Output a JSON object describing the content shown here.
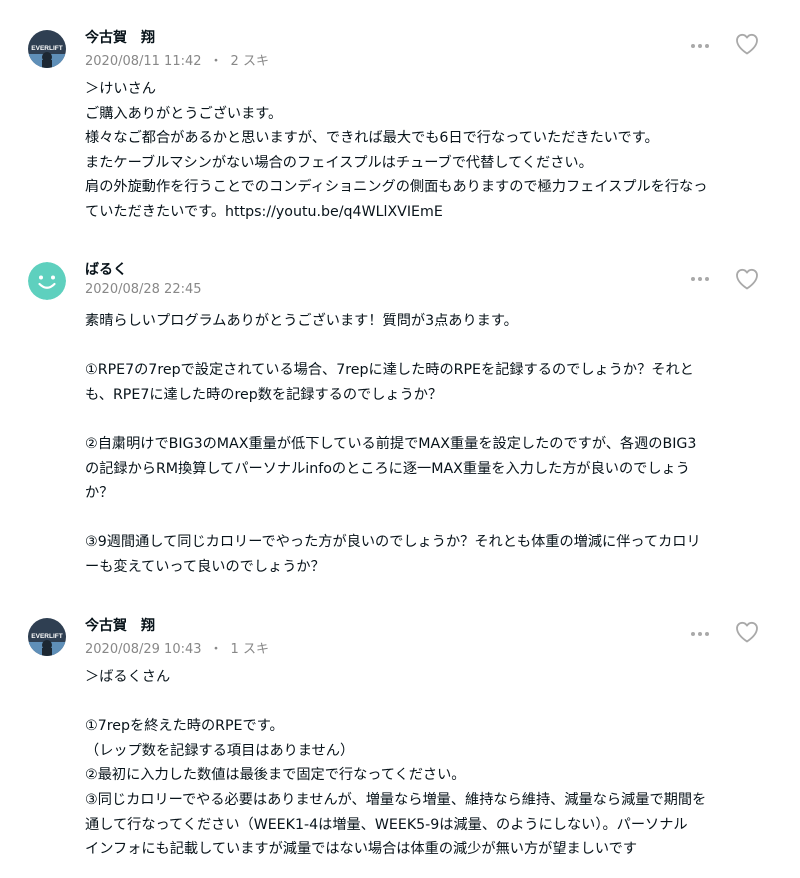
{
  "comments": [
    {
      "author": "今古賀　翔",
      "avatar_icon": "everlift-logo-avatar",
      "date": "2020/08/11 11:42",
      "separator": "・",
      "likes": "2 スキ",
      "lines": [
        "＞けいさん",
        "ご購入ありがとうございます。",
        "様々なご都合があるかと思いますが、できれば最大でも6日で行なっていただきたいです。",
        "またケーブルマシンがない場合のフェイスプルはチューブで代替してください。",
        "肩の外旋動作を行うことでのコンディショニングの側面もありますので極力フェイスプルを行なっ",
        "ていただきたいです。"
      ],
      "link_text": "https://youtu.be/q4WLlXVIEmE"
    },
    {
      "author": "ばるく",
      "avatar_icon": "smiley-face-icon",
      "date": "2020/08/28 22:45",
      "lines": [
        "素晴らしいプログラムありがとうございます！質問が3点あります。",
        "",
        "①RPE7の7repで設定されている場合、7repに達した時のRPEを記録するのでしょうか？それと",
        "も、RPE7に達した時のrep数を記録するのでしょうか？",
        "",
        "②自粛明けでBIG3のMAX重量が低下している前提でMAX重量を設定したのですが、各週のBIG3",
        "の記録からRM換算してパーソナルinfoのところに逐一MAX重量を入力した方が良いのでしょう",
        "か？",
        "",
        "③9週間通して同じカロリーでやった方が良いのでしょうか？それとも体重の増減に伴ってカロリ",
        "ーも変えていって良いのでしょうか？"
      ]
    },
    {
      "author": "今古賀　翔",
      "avatar_icon": "everlift-logo-avatar",
      "date": "2020/08/29 10:43",
      "separator": "・",
      "likes": "1 スキ",
      "lines": [
        "＞ばるくさん",
        "",
        "①7repを終えた時のRPEです。",
        "（レップ数を記録する項目はありません）",
        "②最初に入力した数値は最後まで固定で行なってください。",
        "③同じカロリーでやる必要はありませんが、増量なら増量、維持なら維持、減量なら減量で期間を",
        "通して行なってください（WEEK1-4は増量、WEEK5-9は減量、のようにしない）。パーソナル",
        "インフォにも記載していますが減量ではない場合は体重の減少が無い方が望ましいです"
      ]
    }
  ],
  "avatar_text": "EVERLIFT",
  "icons": {
    "more": "more-horizontal-icon",
    "like": "heart-outline-icon"
  },
  "colors": {
    "text": "#08131a",
    "meta": "#888888",
    "icon": "#a9a9a9",
    "smiley_bg": "#5ed0be"
  }
}
